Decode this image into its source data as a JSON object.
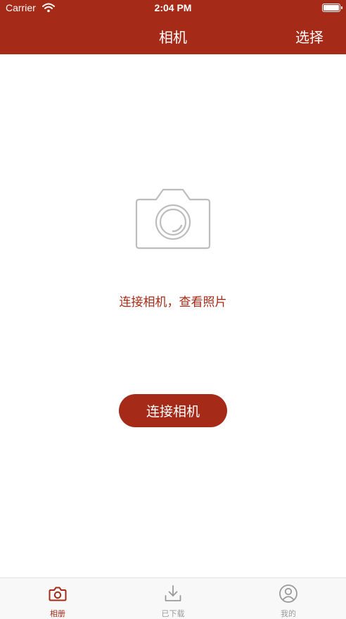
{
  "status_bar": {
    "carrier": "Carrier",
    "time": "2:04 PM",
    "battery_level": 1.0
  },
  "nav": {
    "title": "相机",
    "action_label": "选择"
  },
  "empty_state": {
    "hint": "连接相机，查看照片",
    "button_label": "连接相机"
  },
  "tabs": [
    {
      "label": "相册",
      "icon": "camera-icon",
      "active": true
    },
    {
      "label": "已下载",
      "icon": "download-icon",
      "active": false
    },
    {
      "label": "我的",
      "icon": "user-icon",
      "active": false
    }
  ],
  "colors": {
    "accent": "#a52a17",
    "tab_inactive": "#9a9a9a",
    "illustration": "#bdbdbd",
    "tab_bar_bg": "#f8f8f8"
  }
}
